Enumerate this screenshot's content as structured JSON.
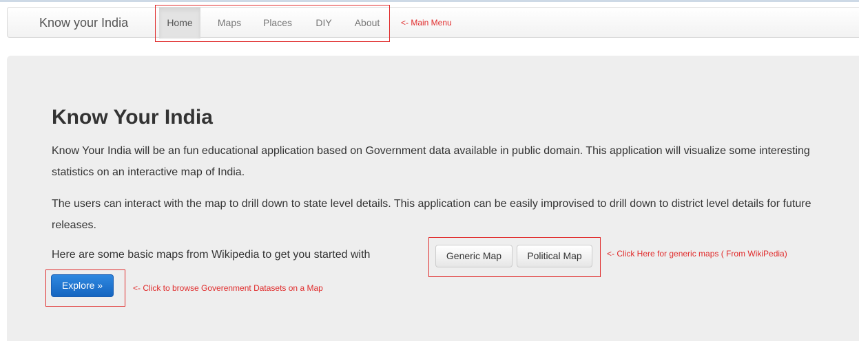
{
  "navbar": {
    "brand": "Know your India",
    "items": [
      {
        "label": "Home",
        "active": true
      },
      {
        "label": "Maps"
      },
      {
        "label": "Places"
      },
      {
        "label": "DIY"
      },
      {
        "label": "About"
      }
    ]
  },
  "annotations": {
    "main_menu": "<- Main Menu",
    "generic_maps": "<- Click Here for generic maps ( From WikiPedia)",
    "explore": "<- Click to browse Goverenment Datasets on a Map"
  },
  "hero": {
    "title": "Know Your India",
    "paragraph1": "Know Your India will be an fun educational application based on Government data available in public domain. This application will visualize some interesting statistics on an interactive map of India.",
    "paragraph2": "The users can interact with the map to drill down to state level details. This application can be easily improvised to drill down to district level details for future releases.",
    "paragraph3": "Here are some basic maps from Wikipedia to get you started with"
  },
  "buttons": {
    "generic_map": "Generic Map",
    "political_map": "Political Map",
    "explore": "Explore »"
  },
  "colors": {
    "annotation": "#e02b2b",
    "primary_button": "#1565c0",
    "jumbotron_bg": "#eeeeee"
  }
}
